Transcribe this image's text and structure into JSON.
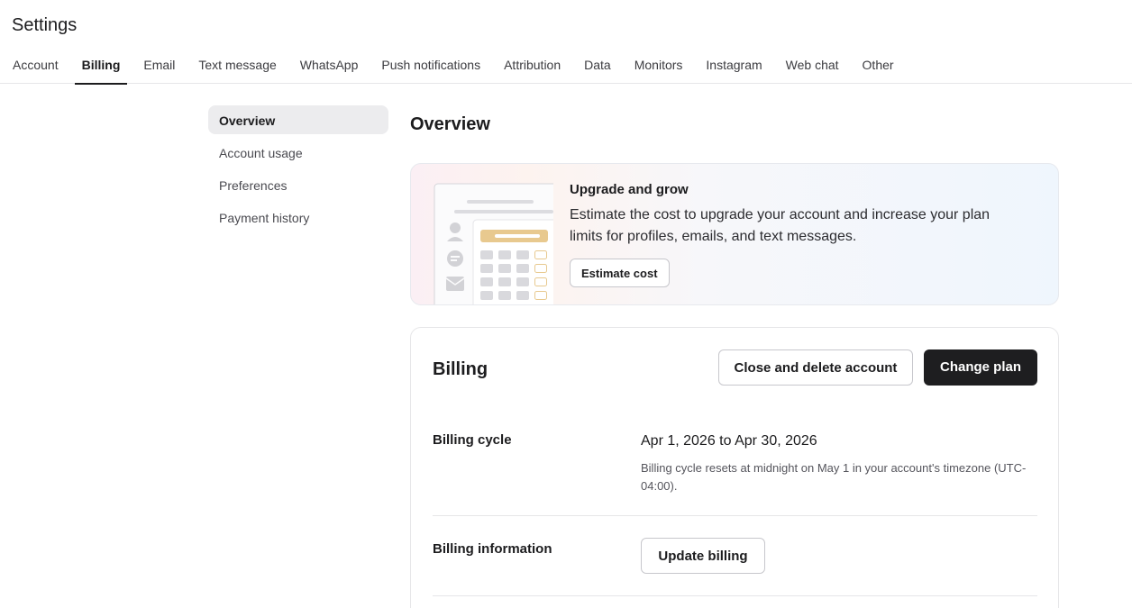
{
  "header": {
    "title": "Settings"
  },
  "tabs": [
    {
      "label": "Account"
    },
    {
      "label": "Billing",
      "active": true
    },
    {
      "label": "Email"
    },
    {
      "label": "Text message"
    },
    {
      "label": "WhatsApp"
    },
    {
      "label": "Push notifications"
    },
    {
      "label": "Attribution"
    },
    {
      "label": "Data"
    },
    {
      "label": "Monitors"
    },
    {
      "label": "Instagram"
    },
    {
      "label": "Web chat"
    },
    {
      "label": "Other"
    }
  ],
  "sidenav": {
    "items": [
      {
        "label": "Overview",
        "active": true
      },
      {
        "label": "Account usage"
      },
      {
        "label": "Preferences"
      },
      {
        "label": "Payment history"
      }
    ]
  },
  "main": {
    "title": "Overview",
    "banner": {
      "heading": "Upgrade and grow",
      "description": "Estimate the cost to upgrade your account and increase your plan limits for profiles, emails, and text messages.",
      "button": "Estimate cost",
      "accent": "#e8c98f"
    },
    "billing": {
      "title": "Billing",
      "close_button": "Close and delete account",
      "change_button": "Change plan",
      "cycle_label": "Billing cycle",
      "cycle_value": "Apr 1, 2026 to Apr 30, 2026",
      "cycle_note": "Billing cycle resets at midnight on May 1 in your account's timezone (UTC-04:00).",
      "info_label": "Billing information",
      "update_button": "Update billing"
    }
  },
  "colors": {
    "primary_button": "#1e1e20",
    "border": "#e6e6e8"
  }
}
